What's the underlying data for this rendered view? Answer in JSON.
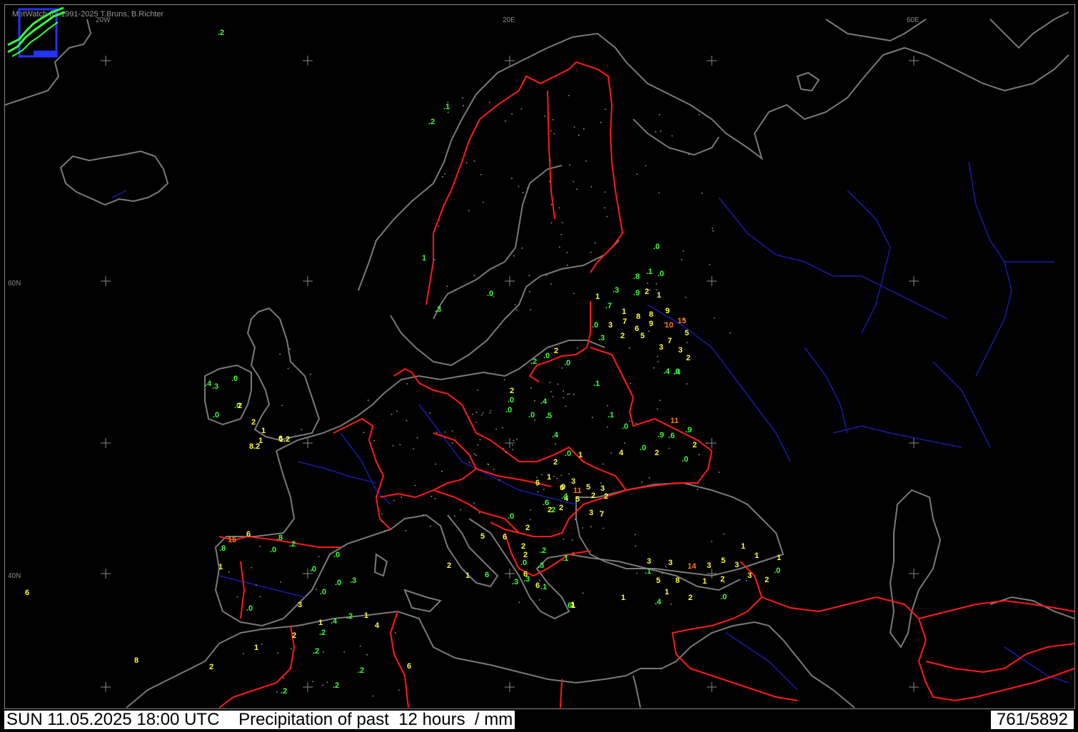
{
  "credit": "MetWatch  (c) 1991-2025 T.Bruns, B.Richter",
  "status": {
    "timestamp": "SUN 11.05.2025 18:00 UTC",
    "title": "Precipitation of past  12 hours  / mm",
    "count": "761/5892"
  },
  "graticule_labels": [
    "20W",
    "20E",
    "60E",
    "60N",
    "40N"
  ],
  "colors": {
    "background": "#000000",
    "coastline": "#7a7a7a",
    "border": "#ff1a1a",
    "river": "#1a1aa8",
    "low_value": "#3cff3c",
    "mid_value": "#ffff40",
    "high_value": "#ff7a1a",
    "logo": "#37ff37"
  },
  "observations": [
    {
      "v": ".2",
      "level": "low"
    },
    {
      "v": ".1",
      "level": "low"
    },
    {
      "v": ".2",
      "level": "low"
    },
    {
      "v": "1",
      "level": "low"
    },
    {
      "v": ".0",
      "level": "low"
    },
    {
      "v": ".3",
      "level": "low"
    },
    {
      "v": ".0",
      "level": "low"
    },
    {
      "v": ".1",
      "level": "low"
    },
    {
      "v": ".0",
      "level": "low"
    },
    {
      "v": ".8",
      "level": "low"
    },
    {
      "v": ".3",
      "level": "low"
    },
    {
      "v": ".9",
      "level": "low"
    },
    {
      "v": "2",
      "level": "mid"
    },
    {
      "v": "1",
      "level": "mid"
    },
    {
      "v": "1",
      "level": "mid"
    },
    {
      "v": ".7",
      "level": "low"
    },
    {
      "v": "1",
      "level": "mid"
    },
    {
      "v": "8",
      "level": "mid"
    },
    {
      "v": "8",
      "level": "mid"
    },
    {
      "v": "9",
      "level": "mid"
    },
    {
      "v": ".0",
      "level": "low"
    },
    {
      "v": "3",
      "level": "mid"
    },
    {
      "v": "7",
      "level": "mid"
    },
    {
      "v": "6",
      "level": "mid"
    },
    {
      "v": "9",
      "level": "mid"
    },
    {
      "v": "10",
      "level": "high"
    },
    {
      "v": "15",
      "level": "high"
    },
    {
      "v": "5",
      "level": "mid"
    },
    {
      "v": ".3",
      "level": "low"
    },
    {
      "v": "2",
      "level": "mid"
    },
    {
      "v": "5",
      "level": "mid"
    },
    {
      "v": "7",
      "level": "mid"
    },
    {
      "v": "3",
      "level": "mid"
    },
    {
      "v": "3",
      "level": "mid"
    },
    {
      "v": "2",
      "level": "mid"
    },
    {
      "v": "2",
      "level": "mid"
    },
    {
      "v": ".2",
      "level": "low"
    },
    {
      "v": ".0",
      "level": "low"
    },
    {
      "v": ".0",
      "level": "low"
    },
    {
      "v": ".4",
      "level": "low"
    },
    {
      "v": ".0",
      "level": "low"
    },
    {
      "v": ".1",
      "level": "low"
    },
    {
      "v": "2",
      "level": "mid"
    },
    {
      "v": ".0",
      "level": "low"
    },
    {
      "v": ".4",
      "level": "low"
    },
    {
      "v": ".0",
      "level": "low"
    },
    {
      "v": ".0",
      "level": "low"
    },
    {
      "v": ".5",
      "level": "low"
    },
    {
      "v": ".4",
      "level": "low"
    },
    {
      "v": ".1",
      "level": "low"
    },
    {
      "v": "11",
      "level": "high"
    },
    {
      "v": ".0",
      "level": "low"
    },
    {
      "v": ".9",
      "level": "low"
    },
    {
      "v": ".6",
      "level": "low"
    },
    {
      "v": ".9",
      "level": "low"
    },
    {
      "v": ".4",
      "level": "low"
    },
    {
      "v": "4",
      "level": "mid"
    },
    {
      "v": "2",
      "level": "mid"
    },
    {
      "v": "2",
      "level": "mid"
    },
    {
      "v": ".0",
      "level": "low"
    },
    {
      "v": ".0",
      "level": "low"
    },
    {
      "v": "1",
      "level": "mid"
    },
    {
      "v": ".0",
      "level": "low"
    },
    {
      "v": "2",
      "level": "mid"
    },
    {
      "v": "1",
      "level": "mid"
    },
    {
      "v": "3",
      "level": "mid"
    },
    {
      "v": "6",
      "level": "mid"
    },
    {
      "v": "9",
      "level": "mid"
    },
    {
      "v": "11",
      "level": "high"
    },
    {
      "v": "5",
      "level": "mid"
    },
    {
      "v": "3",
      "level": "mid"
    },
    {
      "v": "2",
      "level": "mid"
    },
    {
      "v": "2",
      "level": "mid"
    },
    {
      "v": "6",
      "level": "mid"
    },
    {
      "v": "4",
      "level": "mid"
    },
    {
      "v": "5",
      "level": "mid"
    },
    {
      "v": "2",
      "level": "mid"
    },
    {
      "v": "3",
      "level": "mid"
    },
    {
      "v": "7",
      "level": "mid"
    },
    {
      "v": ".6",
      "level": "low"
    },
    {
      "v": ".4",
      "level": "low"
    },
    {
      "v": ".2",
      "level": "low"
    },
    {
      "v": ".1",
      "level": "low"
    },
    {
      "v": "2",
      "level": "mid"
    },
    {
      "v": "15",
      "level": "high"
    },
    {
      "v": "6",
      "level": "mid"
    },
    {
      "v": ".8",
      "level": "low"
    },
    {
      "v": ".8",
      "level": "low"
    },
    {
      "v": ".0",
      "level": "low"
    },
    {
      "v": ".2",
      "level": "low"
    },
    {
      "v": ".0",
      "level": "low"
    },
    {
      "v": "1",
      "level": "mid"
    },
    {
      "v": ".0",
      "level": "low"
    },
    {
      "v": ".0",
      "level": "low"
    },
    {
      "v": ".3",
      "level": "low"
    },
    {
      "v": ".0",
      "level": "low"
    },
    {
      "v": "3",
      "level": "mid"
    },
    {
      "v": ".0",
      "level": "low"
    },
    {
      "v": "6",
      "level": "mid"
    },
    {
      "v": ".4",
      "level": "low"
    },
    {
      "v": ".3",
      "level": "low"
    },
    {
      "v": ".0",
      "level": "low"
    },
    {
      "v": ".0",
      "level": "low"
    },
    {
      "v": ".0",
      "level": "low"
    },
    {
      "v": "2",
      "level": "mid"
    },
    {
      "v": "2",
      "level": "mid"
    },
    {
      "v": "1",
      "level": "mid"
    },
    {
      "v": "1.2",
      "level": "mid"
    },
    {
      "v": "8.2",
      "level": "mid"
    },
    {
      "v": "1",
      "level": "mid"
    },
    {
      "v": "6",
      "level": "mid"
    },
    {
      "v": "3",
      "level": "mid"
    },
    {
      "v": "3",
      "level": "mid"
    },
    {
      "v": "14",
      "level": "high"
    },
    {
      "v": "3",
      "level": "mid"
    },
    {
      "v": "5",
      "level": "mid"
    },
    {
      "v": "3",
      "level": "mid"
    },
    {
      "v": "1",
      "level": "mid"
    },
    {
      "v": "1",
      "level": "mid"
    },
    {
      "v": "1",
      "level": "mid"
    },
    {
      "v": ".0",
      "level": "low"
    },
    {
      "v": "5",
      "level": "mid"
    },
    {
      "v": "8",
      "level": "mid"
    },
    {
      "v": "1",
      "level": "mid"
    },
    {
      "v": "2",
      "level": "mid"
    },
    {
      "v": "3",
      "level": "mid"
    },
    {
      "v": "2",
      "level": "mid"
    },
    {
      "v": ".1",
      "level": "low"
    },
    {
      "v": "1",
      "level": "mid"
    },
    {
      "v": "1",
      "level": "mid"
    },
    {
      "v": ".4",
      "level": "low"
    },
    {
      "v": "2",
      "level": "mid"
    },
    {
      "v": "1",
      "level": "mid"
    },
    {
      "v": ".0",
      "level": "low"
    },
    {
      "v": "2",
      "level": "mid"
    },
    {
      "v": "1",
      "level": "mid"
    },
    {
      "v": ".2",
      "level": "low"
    },
    {
      "v": ".4",
      "level": "low"
    },
    {
      "v": ".2",
      "level": "low"
    },
    {
      "v": "1",
      "level": "mid"
    },
    {
      "v": "4",
      "level": "mid"
    },
    {
      "v": "1",
      "level": "mid"
    },
    {
      "v": ".2",
      "level": "low"
    },
    {
      "v": "8",
      "level": "mid"
    },
    {
      "v": ".2",
      "level": "low"
    },
    {
      "v": "2",
      "level": "mid"
    },
    {
      "v": ".2",
      "level": "low"
    },
    {
      "v": ".2",
      "level": "low"
    },
    {
      "v": "6",
      "level": "mid"
    },
    {
      "v": "2",
      "level": "mid"
    },
    {
      "v": "1",
      "level": "mid"
    },
    {
      "v": "6",
      "level": "low"
    },
    {
      "v": "5",
      "level": "mid"
    },
    {
      "v": "6",
      "level": "mid"
    },
    {
      "v": "2",
      "level": "mid"
    },
    {
      "v": ".2",
      "level": "low"
    },
    {
      "v": "6",
      "level": "mid"
    },
    {
      "v": ".0",
      "level": "low"
    },
    {
      "v": ".3",
      "level": "low"
    },
    {
      "v": ".3",
      "level": "low"
    },
    {
      "v": ".1",
      "level": "low"
    },
    {
      "v": "6",
      "level": "low"
    },
    {
      "v": ".3",
      "level": "low"
    },
    {
      "v": "6",
      "level": "mid"
    },
    {
      "v": ".0",
      "level": "low"
    },
    {
      "v": "2",
      "level": "mid"
    },
    {
      "v": "2",
      "level": "mid"
    },
    {
      "v": "1",
      "level": "mid"
    },
    {
      "v": ".0",
      "level": "low"
    }
  ]
}
